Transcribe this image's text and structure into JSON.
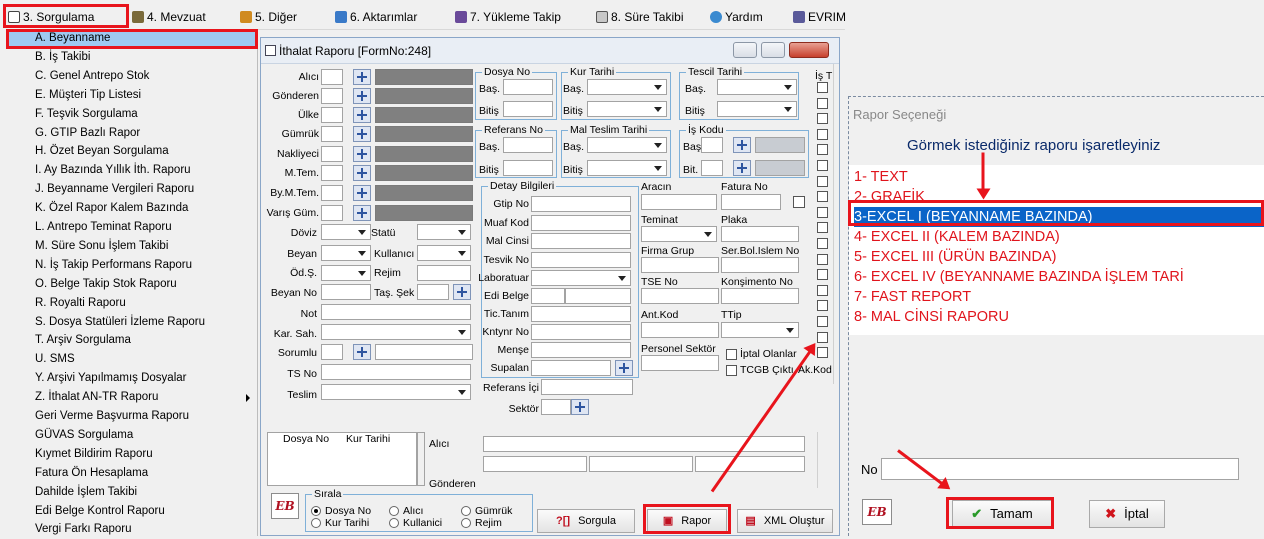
{
  "menubar": {
    "items": [
      {
        "label": "3. Sorgulama",
        "icon": "search-icon"
      },
      {
        "label": "4. Mevzuat",
        "icon": "books-icon"
      },
      {
        "label": "5. Diğer",
        "icon": "tools-icon"
      },
      {
        "label": "6. Aktarımlar",
        "icon": "transfer-icon"
      },
      {
        "label": "7. Yükleme Takip",
        "icon": "truck-icon"
      },
      {
        "label": "8. Süre Takibi",
        "icon": "calendar-icon"
      },
      {
        "label": "Yardım",
        "icon": "help-icon"
      },
      {
        "label": "EVRIM",
        "icon": "document-icon"
      }
    ]
  },
  "dropdown": {
    "items": [
      "A. Beyanname",
      "B. İş Takibi",
      "C. Genel Antrepo Stok",
      "E. Müşteri Tip Listesi",
      "F. Teşvik Sorgulama",
      "G. GTIP Bazlı Rapor",
      "H. Özet Beyan Sorgulama",
      "I. Ay Bazında Yıllık İth. Raporu",
      "J. Beyanname Vergileri Raporu",
      "K. Özel Rapor Kalem Bazında",
      "L. Antrepo Teminat Raporu",
      "M. Süre Sonu İşlem Takibi",
      "N. İş Takip Performans Raporu",
      "O. Belge Takip Stok Raporu",
      "R. Royalti Raporu",
      "S. Dosya Statüleri İzleme Raporu",
      "T. Arşiv Sorgulama",
      "U. SMS",
      "Y. Arşivi Yapılmamış Dosyalar",
      "Z. İthalat AN-TR Raporu",
      "Geri Verme Başvurma Raporu",
      "GÜVAS Sorgulama",
      "Kıymet Bildirim Raporu",
      "Fatura Ön Hesaplama",
      "Dahilde İşlem Takibi",
      "Edi Belge Kontrol Raporu",
      "Vergi Farkı Raporu"
    ]
  },
  "form": {
    "title": "İthalat Raporu [FormNo:248]",
    "left_labels": [
      "Alıcı",
      "Gönderen",
      "Ülke",
      "Gümrük",
      "Nakliyeci",
      "M.Tem.",
      "By.M.Tem.",
      "Varış Güm."
    ],
    "doviz": "Döviz",
    "statu": "Statü",
    "beyan": "Beyan",
    "kullanici": "Kullanıcı",
    "odsekli": "Öd.Ş.",
    "rejim": "Rejim",
    "beyan_no": "Beyan No",
    "tas_sekli": "Taş. Şek",
    "not": "Not ",
    "kar_sah": "Kar. Sah.",
    "sorumlu": "Sorumlu",
    "ts_no": "TS No",
    "teslim": "Teslim",
    "dosya_no": "Dosya No",
    "kur_tarihi": "Kur Tarihi",
    "tescil_tarihi": "Tescil Tarihi",
    "referans_no": "Referans No",
    "mal_teslim_tarihi": "Mal Teslim Tarihi",
    "is_kodu": "İş Kodu",
    "bas": "Baş.",
    "bitis": "Bitiş",
    "bit": "Bit.",
    "detay_bilgileri": "Detay Bilgileri",
    "detay_labels": [
      "Gtip No",
      "Muaf Kod",
      "Mal Cinsi",
      "Tesvik No",
      "Laboratuar",
      "Edi Belge",
      "Tic.Tanım",
      "Kntynr No",
      "Menşe",
      "Supalan"
    ],
    "aracin": "Aracın",
    "fatura_no": "Fatura No",
    "teminat": "Teminat",
    "plaka": "Plaka",
    "firma_grup": "Firma Grup",
    "ser_bol": "Ser.Bol.Islem No",
    "tse_no": "TSE No",
    "konsimento": "Konşimento No",
    "ant_kod": "Ant.Kod",
    "ttip": "TTip",
    "personel_sektor": "Personel Sektör",
    "iptal_olanlar": "İptal Olanlar",
    "tcgb": "TCGB Çıktı",
    "ak_kod": "Ak.Kod",
    "referans_ici": "Referans İçi",
    "sektor": "Sektör",
    "is_t": "İş T",
    "grid_col1": "Dosya No",
    "grid_col2": "Kur Tarihi",
    "grid_alici": "Alıcı",
    "grid_gonderen": "Gönderen",
    "sirala": "Sırala",
    "sort_options": [
      "Dosya No",
      "Alıcı",
      "Gümrük",
      "Kur Tarihi",
      "Kullanici",
      "Rejim"
    ],
    "btn_sorgula": "Sorgula",
    "btn_rapor": "Rapor",
    "btn_xml": "XML Oluştur",
    "badge": "EB"
  },
  "dialog": {
    "title": "Rapor Seçeneği",
    "prompt": "Görmek istediğiniz raporu işaretleyiniz",
    "options": [
      "1- TEXT",
      "2- GRAFİK",
      "3-EXCEL I (BEYANNAME BAZINDA)",
      "4- EXCEL II (KALEM BAZINDA)",
      "5- EXCEL III (ÜRÜN BAZINDA)",
      "6- EXCEL IV (BEYANNAME BAZINDA İŞLEM TARİ",
      "7- FAST REPORT",
      "8- MAL CİNSİ RAPORU"
    ],
    "no_label": "No",
    "ok": "Tamam",
    "cancel": "İptal",
    "badge": "EB"
  },
  "colors": {
    "highlight": "#e8141c",
    "selected": "#0a64c8"
  }
}
